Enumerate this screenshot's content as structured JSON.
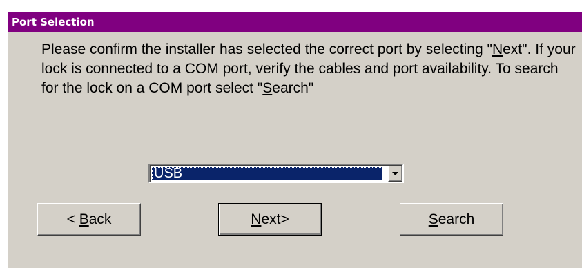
{
  "dialog": {
    "title": "Port Selection",
    "message": {
      "part1": "Please confirm the installer has selected the correct port by selecting \"",
      "next_mnemonic": "N",
      "next_rest": "ext",
      "part2": "\". If your lock is connected to a COM port, verify the cables and port availability. To search for the lock on a COM port select \"",
      "search_mnemonic": "S",
      "search_rest": "earch",
      "part3": "\""
    }
  },
  "port_select": {
    "selected_value": "USB"
  },
  "buttons": {
    "back": {
      "prefix": "< ",
      "mnemonic": "B",
      "rest": "ack"
    },
    "next": {
      "mnemonic": "N",
      "rest": "ext>"
    },
    "search": {
      "mnemonic": "S",
      "rest": "earch"
    }
  },
  "colors": {
    "title_bar": "#800080",
    "dialog_bg": "#d4d0c8",
    "selection_bg": "#0a246a"
  },
  "icons": {
    "dropdown": "chevron-down-icon"
  }
}
